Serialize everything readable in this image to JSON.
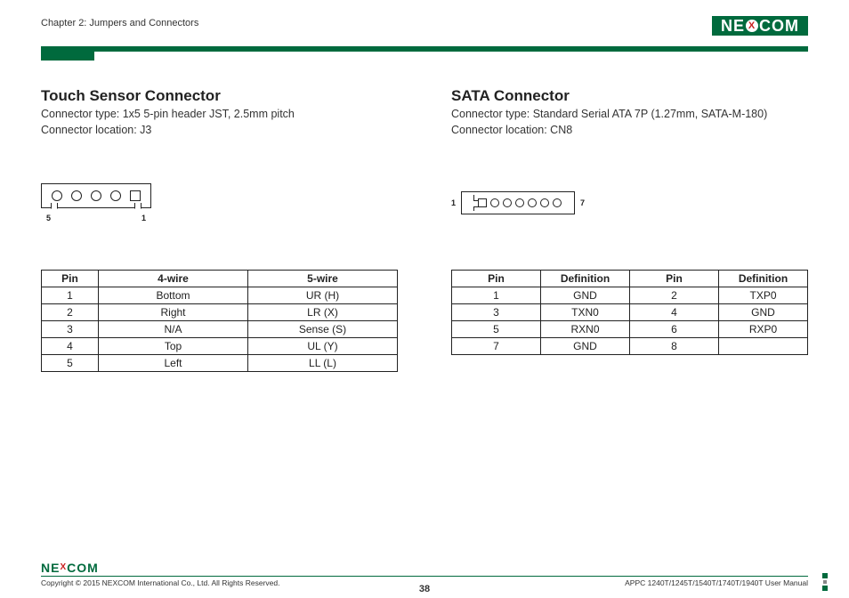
{
  "header": {
    "chapter": "Chapter 2: Jumpers and Connectors",
    "brand_pre": "NE",
    "brand_x": "X",
    "brand_post": "COM"
  },
  "left": {
    "title": "Touch Sensor Connector",
    "type": "Connector type: 1x5 5-pin header JST, 2.5mm pitch",
    "loc": "Connector location: J3",
    "pin_left_lbl": "5",
    "pin_right_lbl": "1",
    "table": {
      "headers": [
        "Pin",
        "4-wire",
        "5-wire"
      ],
      "rows": [
        [
          "1",
          "Bottom",
          "UR (H)"
        ],
        [
          "2",
          "Right",
          "LR (X)"
        ],
        [
          "3",
          "N/A",
          "Sense (S)"
        ],
        [
          "4",
          "Top",
          "UL (Y)"
        ],
        [
          "5",
          "Left",
          "LL (L)"
        ]
      ]
    }
  },
  "right": {
    "title": "SATA Connector",
    "type": "Connector type: Standard Serial ATA 7P (1.27mm, SATA-M-180)",
    "loc": "Connector location: CN8",
    "pin_left_lbl": "1",
    "pin_right_lbl": "7",
    "table": {
      "headers": [
        "Pin",
        "Definition",
        "Pin",
        "Definition"
      ],
      "rows": [
        [
          "1",
          "GND",
          "2",
          "TXP0"
        ],
        [
          "3",
          "TXN0",
          "4",
          "GND"
        ],
        [
          "5",
          "RXN0",
          "6",
          "RXP0"
        ],
        [
          "7",
          "GND",
          "8",
          ""
        ]
      ]
    }
  },
  "footer": {
    "copyright": "Copyright © 2015 NEXCOM International Co., Ltd. All Rights Reserved.",
    "page": "38",
    "manual": "APPC 1240T/1245T/1540T/1740T/1940T User Manual"
  }
}
